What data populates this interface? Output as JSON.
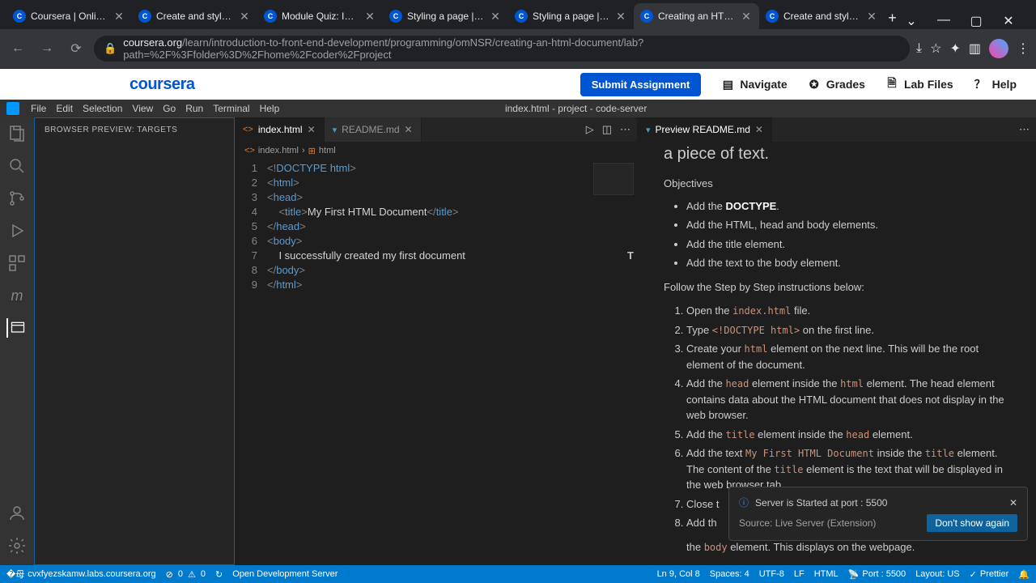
{
  "browser": {
    "tabs": [
      {
        "title": "Coursera | Online Cou"
      },
      {
        "title": "Create and style a we"
      },
      {
        "title": "Module Quiz: Introdu"
      },
      {
        "title": "Styling a page | Cours"
      },
      {
        "title": "Styling a page | Cours"
      },
      {
        "title": "Creating an HTML Do",
        "active": true
      },
      {
        "title": "Create and style a we"
      }
    ],
    "url_domain": "coursera.org",
    "url_path": "/learn/introduction-to-front-end-development/programming/omNSR/creating-an-html-document/lab?path=%2F%3Ffolder%3D%2Fhome%2Fcoder%2Fproject"
  },
  "coursera": {
    "logo": "coursera",
    "submit": "Submit Assignment",
    "navigate": "Navigate",
    "grades": "Grades",
    "labfiles": "Lab Files",
    "help": "Help"
  },
  "vscode": {
    "menu": [
      "File",
      "Edit",
      "Selection",
      "View",
      "Go",
      "Run",
      "Terminal",
      "Help"
    ],
    "window_title": "index.html - project - code-server",
    "sidebar_header": "BROWSER PREVIEW: TARGETS",
    "editor_tabs_left": [
      {
        "name": "index.html",
        "active": true
      },
      {
        "name": "README.md"
      }
    ],
    "editor_tabs_right": [
      {
        "name": "Preview README.md",
        "active": true
      }
    ],
    "breadcrumb": {
      "file": "index.html",
      "sym": "html"
    },
    "code": [
      {
        "n": 1,
        "h": "<span class='tk-brk'>&lt;!</span><span class='tk-doc'>DOCTYPE</span> <span class='tk-tag'>html</span><span class='tk-brk'>&gt;</span>"
      },
      {
        "n": 2,
        "h": "<span class='tk-brk'>&lt;</span><span class='tk-tag'>html</span><span class='tk-brk'>&gt;</span>"
      },
      {
        "n": 3,
        "h": "<span class='tk-brk'>&lt;</span><span class='tk-tag'>head</span><span class='tk-brk'>&gt;</span>"
      },
      {
        "n": 4,
        "h": "    <span class='tk-brk'>&lt;</span><span class='tk-tag'>title</span><span class='tk-brk'>&gt;</span><span class='tk-txt'>My First HTML Document</span><span class='tk-brk'>&lt;/</span><span class='tk-tag'>title</span><span class='tk-brk'>&gt;</span>"
      },
      {
        "n": 5,
        "h": "<span class='tk-brk'>&lt;/</span><span class='tk-tag'>head</span><span class='tk-brk'>&gt;</span>"
      },
      {
        "n": 6,
        "h": "<span class='tk-brk'>&lt;</span><span class='tk-tag'>body</span><span class='tk-brk'>&gt;</span>"
      },
      {
        "n": 7,
        "h": "    <span class='tk-txt'>I successfully created my first document</span>"
      },
      {
        "n": 8,
        "h": "<span class='tk-brk'>&lt;/</span><span class='tk-tag'>body</span><span class='tk-brk'>&gt;</span>"
      },
      {
        "n": 9,
        "h": "<span class='tk-brk'>&lt;/</span><span class='tk-tag'>html</span><span class='tk-brk'>&gt;</span>"
      }
    ],
    "preview": {
      "heading_tail": "a piece of text.",
      "objectives_label": "Objectives",
      "objectives": [
        "Add the <strong>DOCTYPE</strong>.",
        "Add the HTML, head and body elements.",
        "Add the title element.",
        "Add the text to the body element."
      ],
      "follow": "Follow the Step by Step instructions below:",
      "steps": [
        "Open the <code>index.html</code> file.",
        "Type <code>&lt;!DOCTYPE html&gt;</code> on the first line.",
        "Create your <code>html</code> element on the next line. This will be the root element of the document.",
        "Add the <code>head</code> element inside the <code>html</code> element. The head element contains data about the HTML document that does not display in the web browser.",
        "Add the <code>title</code> element inside the <code>head</code> element.",
        "Add the text <code>My First HTML Document</code> inside the <code>title</code> element. The content of the <code>title</code> element is the text that will be displayed in the web browser tab.",
        "Close t",
        "Add th"
      ],
      "step8_tail": "the <code>body</code> element. This displays on the webpage."
    },
    "toast": {
      "msg": "Server is Started at port : 5500",
      "source": "Source: Live Server (Extension)",
      "button": "Don't show again"
    },
    "status": {
      "host": "cvxfyezskamw.labs.coursera.org",
      "errors": "0",
      "warnings": "0",
      "server": "Open Development Server",
      "pos": "Ln 9, Col 8",
      "spaces": "Spaces: 4",
      "enc": "UTF-8",
      "eol": "LF",
      "lang": "HTML",
      "port": "Port : 5500",
      "layout": "Layout: US",
      "prettier": "Prettier"
    }
  }
}
